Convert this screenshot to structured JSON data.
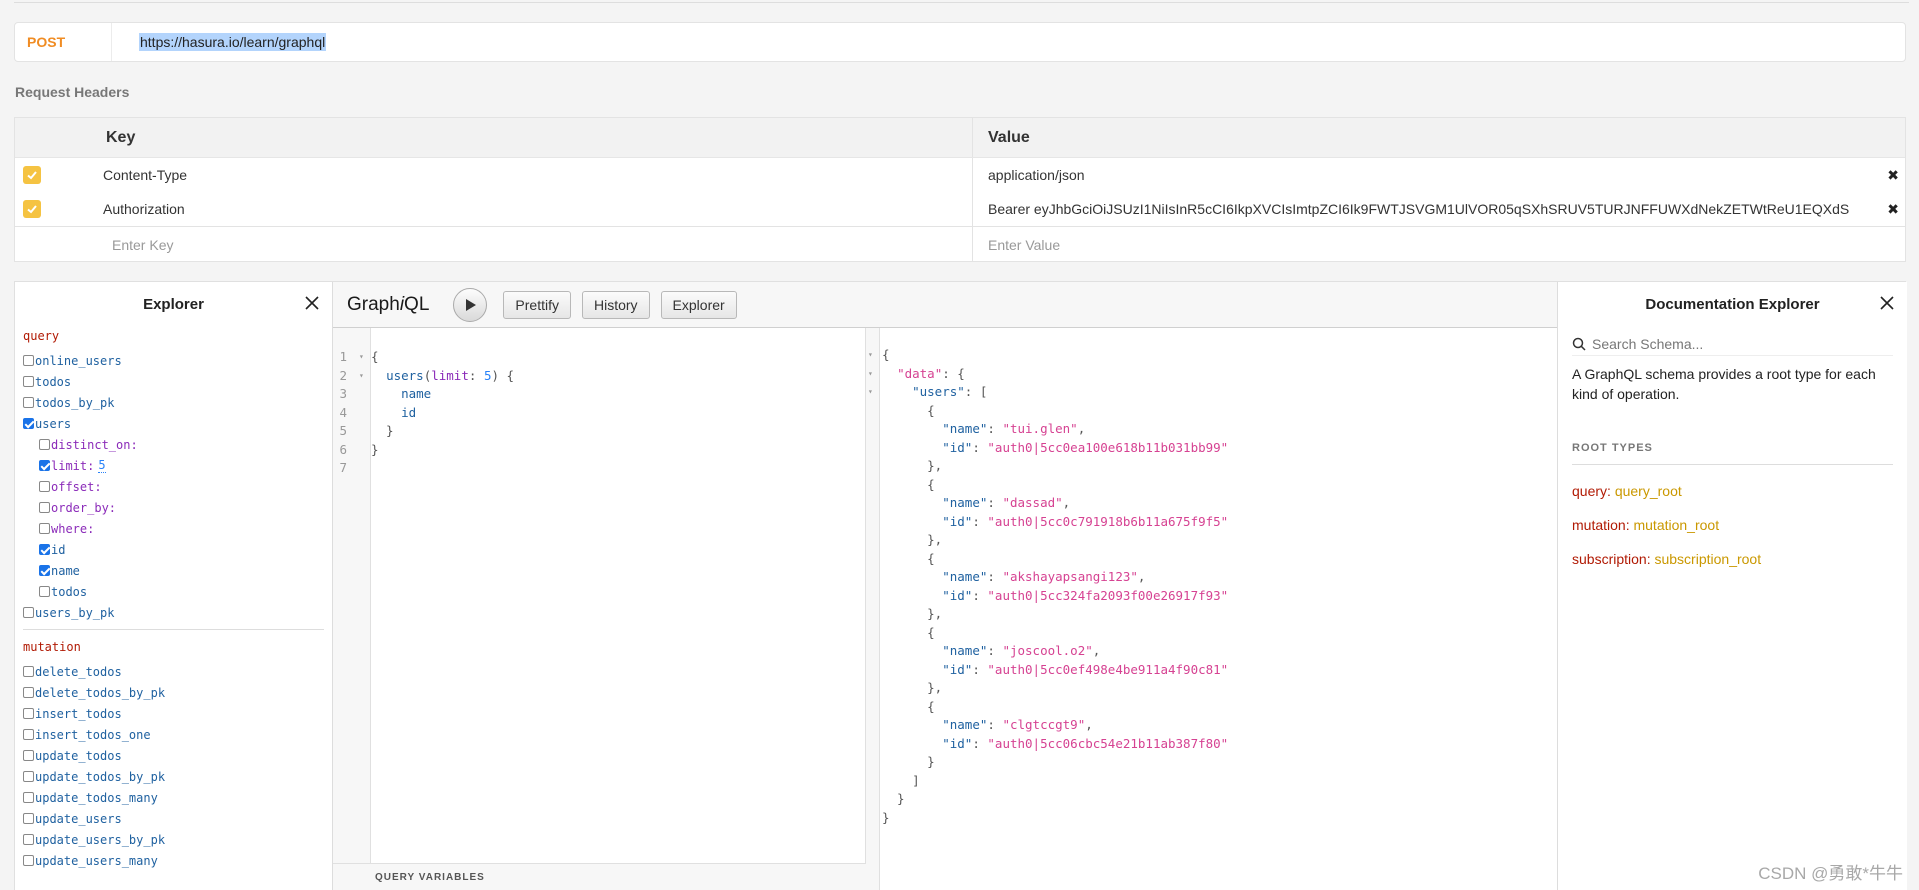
{
  "request": {
    "method": "POST",
    "url": "https://hasura.io/learn/graphql"
  },
  "headers": {
    "title": "Request Headers",
    "key_col": "Key",
    "value_col": "Value",
    "rows": [
      {
        "key": "Content-Type",
        "value": "application/json"
      },
      {
        "key": "Authorization",
        "value": "Bearer eyJhbGciOiJSUzI1NiIsInR5cCI6IkpXVCIsImtpZCI6Ik9FWTJSVGM1UlVOR05qSXhSRUV5TURJNFFUWXdNekZETWtReU1EQXdS"
      }
    ],
    "key_placeholder": "Enter Key",
    "value_placeholder": "Enter Value"
  },
  "explorer": {
    "title": "Explorer",
    "query_label": "query",
    "query_fields": [
      "online_users",
      "todos",
      "todos_by_pk",
      "users"
    ],
    "users_args": [
      "distinct_on:",
      "limit:",
      "offset:",
      "order_by:",
      "where:"
    ],
    "limit_value": "5",
    "users_fields": [
      "id",
      "name",
      "todos"
    ],
    "after_users": "users_by_pk",
    "mutation_label": "mutation",
    "mutation_fields": [
      "delete_todos",
      "delete_todos_by_pk",
      "insert_todos",
      "insert_todos_one",
      "update_todos",
      "update_todos_by_pk",
      "update_todos_many",
      "update_users",
      "update_users_by_pk",
      "update_users_many"
    ]
  },
  "graphiql": {
    "title_pre": "Graph",
    "title_i": "i",
    "title_post": "QL",
    "prettify": "Prettify",
    "history": "History",
    "explorer_btn": "Explorer",
    "query_variables": "QUERY VARIABLES",
    "query_lines": [
      "{",
      "  users(limit: 5) {",
      "    name",
      "    id",
      "  }",
      "}",
      ""
    ],
    "result": {
      "data_key": "\"data\"",
      "users_key": "\"users\"",
      "users": [
        {
          "name": "tui.glen",
          "id": "auth0|5cc0ea100e618b11b031bb99"
        },
        {
          "name": "dassad",
          "id": "auth0|5cc0c791918b6b11a675f9f5"
        },
        {
          "name": "akshayapsangi123",
          "id": "auth0|5cc324fa2093f00e26917f93"
        },
        {
          "name": "joscool.o2",
          "id": "auth0|5cc0ef498e4be911a4f90c81"
        },
        {
          "name": "clgtccgt9",
          "id": "auth0|5cc06cbc54e21b11ab387f80"
        }
      ]
    }
  },
  "docs": {
    "title": "Documentation Explorer",
    "search_placeholder": "Search Schema...",
    "description": "A GraphQL schema provides a root type for each kind of operation.",
    "root_types_label": "ROOT TYPES",
    "roots": [
      {
        "key": "query",
        "type": "query_root"
      },
      {
        "key": "mutation",
        "type": "mutation_root"
      },
      {
        "key": "subscription",
        "type": "subscription_root"
      }
    ]
  },
  "watermark": "CSDN @勇敢*牛牛"
}
